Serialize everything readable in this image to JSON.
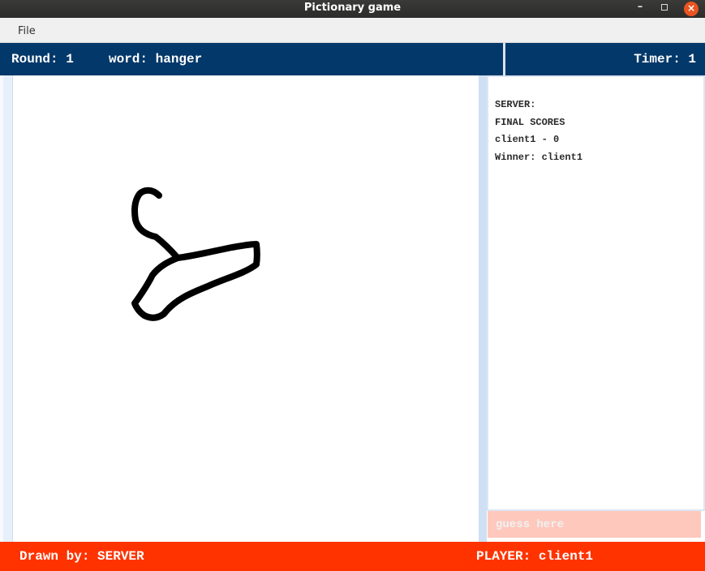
{
  "window": {
    "title": "Pictionary game",
    "minimize_glyph": "–",
    "close_glyph": "×"
  },
  "menu": {
    "file_label": "File"
  },
  "header": {
    "round_label": "Round: 1",
    "word_label": "word: hanger",
    "timer_label": "Timer: 1"
  },
  "canvas": {
    "drawing_subject": "hanger",
    "stroke_color": "#000000"
  },
  "chat": {
    "lines": [
      "SERVER:",
      "FINAL SCORES",
      "client1 - 0",
      "Winner: client1"
    ],
    "guess_placeholder": "guess here"
  },
  "footer": {
    "drawn_by_label": "Drawn by: SERVER",
    "player_label": "PLAYER: client1"
  },
  "colors": {
    "header_bg": "#03386a",
    "footer_bg": "#ff3300",
    "guess_bg": "#ffc8bd",
    "close_button": "#e95420"
  },
  "icons": {
    "minimize": "minimize-icon",
    "maximize": "maximize-icon",
    "close": "close-icon"
  }
}
